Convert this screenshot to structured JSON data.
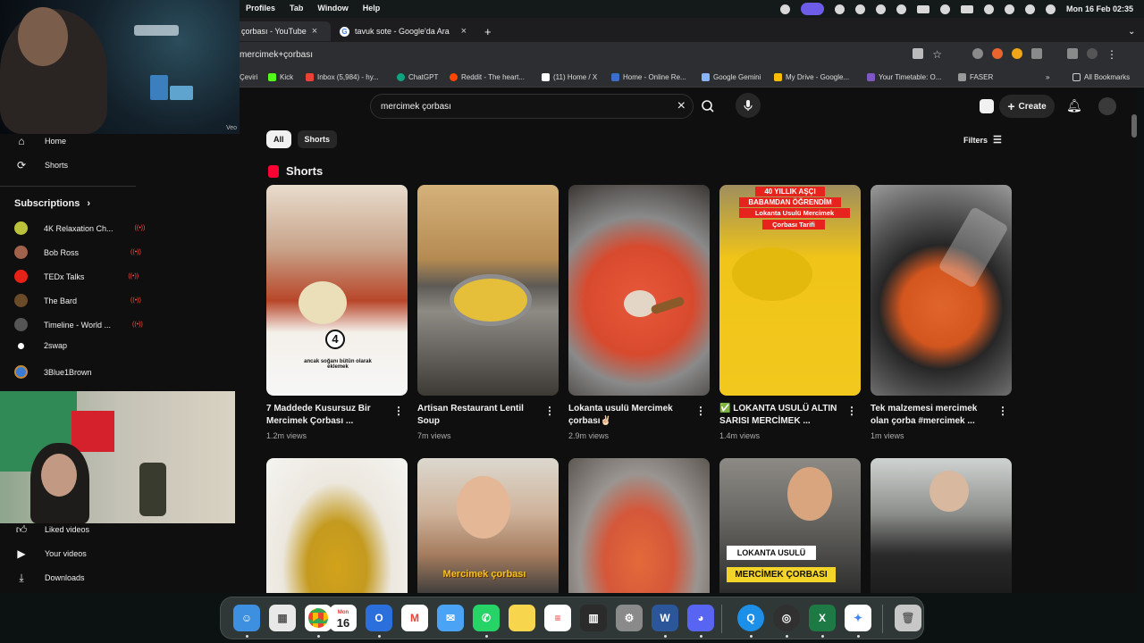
{
  "menubar": {
    "menus": [
      "Profiles",
      "Tab",
      "Window",
      "Help"
    ],
    "datetime": "Mon 16 Feb  02:35"
  },
  "tabs": [
    {
      "title": "çorbası - YouTube",
      "active": true
    },
    {
      "title": "tavuk sote - Google'da Ara",
      "active": false
    }
  ],
  "address": {
    "url": "mercimek+çorbası"
  },
  "bookmarks": [
    {
      "label": "Çeviri",
      "color": "#4285f4"
    },
    {
      "label": "Kick",
      "color": "#53fc18"
    },
    {
      "label": "Inbox (5,984) - hy...",
      "color": "#ea4335"
    },
    {
      "label": "ChatGPT",
      "color": "#10a37f"
    },
    {
      "label": "Reddit - The heart...",
      "color": "#ff4500"
    },
    {
      "label": "(11) Home / X",
      "color": "#ffffff"
    },
    {
      "label": "Home - Online Re...",
      "color": "#3b6ecc"
    },
    {
      "label": "Google Gemini",
      "color": "#8ab4f8"
    },
    {
      "label": "My Drive - Google...",
      "color": "#fbbc04"
    },
    {
      "label": "Your Timetable: O...",
      "color": "#7e57c2"
    },
    {
      "label": "FASER",
      "color": "#999999"
    },
    {
      "label": "All Bookmarks",
      "color": "#cccccc"
    }
  ],
  "youtube": {
    "search_value": "mercimek çorbası",
    "create_label": "Create",
    "chips": [
      "All",
      "Shorts"
    ],
    "filters_label": "Filters",
    "shorts_heading": "Shorts",
    "sidebar": {
      "top_items": [
        {
          "label": "Home",
          "icon": "home-icon"
        },
        {
          "label": "Shorts",
          "icon": "shorts-icon"
        }
      ],
      "subscriptions_label": "Subscriptions",
      "subscriptions": [
        {
          "name": "4K Relaxation Ch...",
          "color": "#b9c23a",
          "live": true
        },
        {
          "name": "Bob Ross",
          "color": "#a0624a",
          "live": true
        },
        {
          "name": "TEDx Talks",
          "color": "#e62117",
          "live": true
        },
        {
          "name": "The Bard",
          "color": "#6b4a2a",
          "live": true
        },
        {
          "name": "Timeline - World ...",
          "color": "#555555",
          "live": true
        },
        {
          "name": "2swap",
          "color": "#ffffff",
          "live": false
        },
        {
          "name": "3Blue1Brown",
          "color": "#3a7bd5",
          "live": false
        }
      ],
      "bottom_items": [
        {
          "label": "Liked videos",
          "icon": "thumbs-up-icon"
        },
        {
          "label": "Your videos",
          "icon": "play-square-icon"
        },
        {
          "label": "Downloads",
          "icon": "download-icon"
        }
      ]
    },
    "shorts": [
      {
        "title": "7 Maddede Kusursuz Bir Mercimek Çorbası ...",
        "views": "1.2m views",
        "overlay_number": "4",
        "overlay_caption": "ancak soğanı bütün olarak eklemek"
      },
      {
        "title": "Artisan Restaurant Lentil Soup",
        "views": "7m views"
      },
      {
        "title": "Lokanta usulü Mercimek çorbası✌🏻",
        "views": "2.9m views"
      },
      {
        "title": "✅ LOKANTA USULÜ ALTIN SARISI MERCİMEK ...",
        "views": "1.4m views",
        "overlay_line1": "40 YILLIK AŞÇI",
        "overlay_line2": "BABAMDAN ÖĞRENDİM",
        "overlay_line3": "Lokanta Usulü  Mercimek",
        "overlay_line4": "Çorbası Tarifi"
      },
      {
        "title": "Tek malzemesi mercimek olan çorba #mercimek ...",
        "views": "1m views"
      }
    ],
    "row2_overlays": {
      "card2": "Mercimek çorbası",
      "card4_line1": "LOKANTA USULÜ",
      "card4_line2": "MERCİMEK ÇORBASI"
    }
  },
  "cam_label": "Veo",
  "dock": [
    {
      "name": "finder-icon",
      "color": "#3d8fe0"
    },
    {
      "name": "launchpad-icon",
      "color": "#e8e8e8"
    },
    {
      "name": "chrome-icon",
      "color": "#ffffff"
    },
    {
      "name": "calendar-icon",
      "color": "#ffffff",
      "text": "16",
      "subtext": "Mon"
    },
    {
      "name": "outlook-icon",
      "color": "#2a6fdb"
    },
    {
      "name": "gmail-icon",
      "color": "#ffffff"
    },
    {
      "name": "mail-icon",
      "color": "#4aa3f5"
    },
    {
      "name": "whatsapp-icon",
      "color": "#25d366"
    },
    {
      "name": "notes-icon",
      "color": "#f7d54c"
    },
    {
      "name": "reminders-icon",
      "color": "#ffffff"
    },
    {
      "name": "app-store-icon",
      "color": "#2b2b2b"
    },
    {
      "name": "system-settings-icon",
      "color": "#8a8a8a"
    },
    {
      "name": "word-icon",
      "color": "#2b579a"
    },
    {
      "name": "discord-icon",
      "color": "#5865f2"
    },
    {
      "name": "quicktime-icon",
      "color": "#1c8fe8"
    },
    {
      "name": "obs-icon",
      "color": "#303030"
    },
    {
      "name": "excel-icon",
      "color": "#1e7a45"
    },
    {
      "name": "gemini-icon",
      "color": "#ffffff"
    },
    {
      "name": "trash-icon",
      "color": "#c7c7c7"
    }
  ]
}
